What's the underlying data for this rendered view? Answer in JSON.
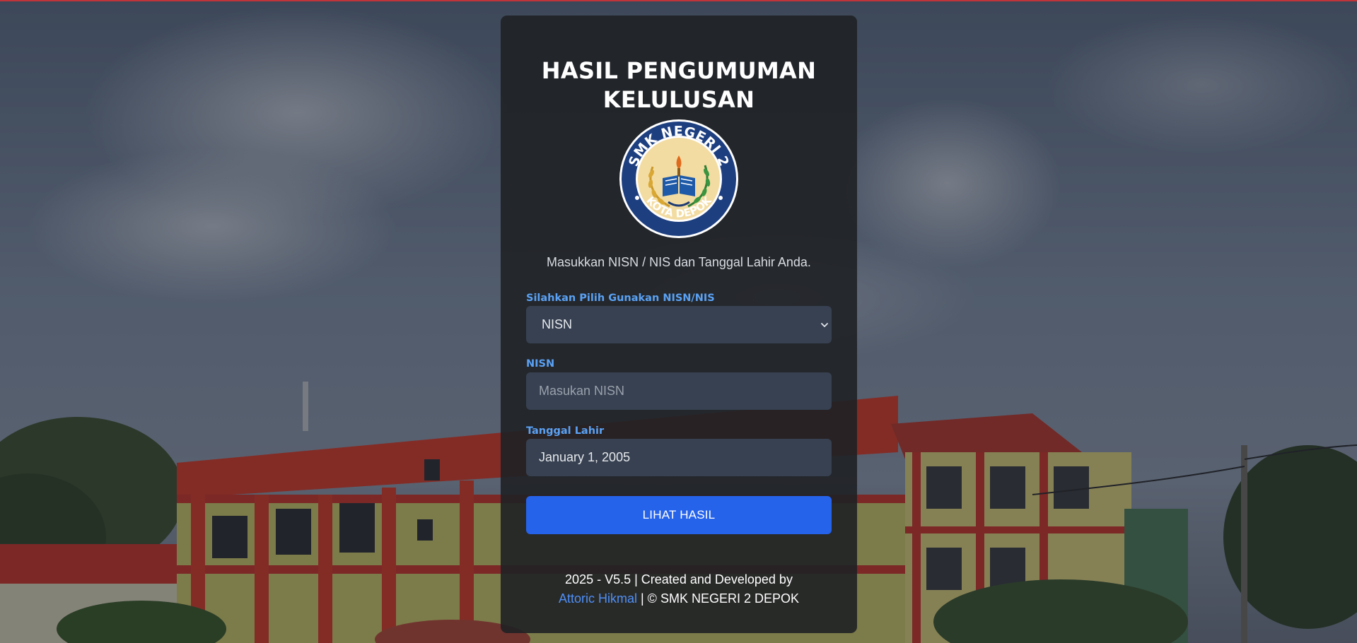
{
  "colors": {
    "accent_label": "#5aa2f5",
    "button": "#2563eb",
    "card_bg": "#1f2125",
    "control_bg": "#374151",
    "link": "#4f8ff7",
    "top_border": "#c0343a"
  },
  "header": {
    "title_line1": "HASIL PENGUMUMAN",
    "title_line2": "KELULUSAN"
  },
  "logo": {
    "text_top": "SMK NEGERI 2",
    "text_bottom": "KOTA DEPOK",
    "icon": "school-emblem-icon"
  },
  "instruction": "Masukkan NISN / NIS dan Tanggal Lahir Anda.",
  "form": {
    "mode_label": "Silahkan Pilih Gunakan NISN/NIS",
    "mode_selected": "NISN",
    "nisn_label": "NISN",
    "nisn_placeholder": "Masukan NISN",
    "nisn_value": "",
    "date_label": "Tanggal Lahir",
    "date_value": "January 1, 2005",
    "submit_label": "LIHAT HASIL"
  },
  "footer": {
    "line1": "2025 - V5.5 | Created and Developed by",
    "author_link": "Attoric Hikmal",
    "line2_suffix": " | © SMK NEGERI 2 DEPOK"
  }
}
